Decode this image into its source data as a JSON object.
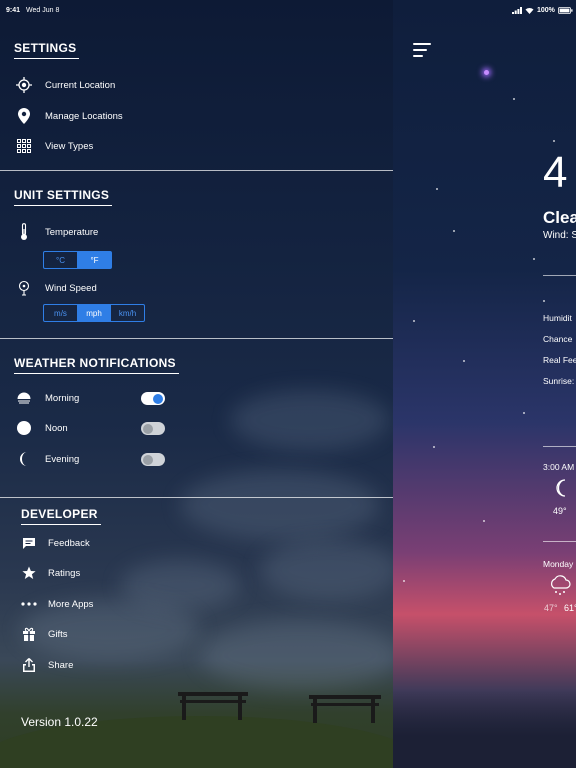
{
  "status_bar": {
    "time": "9:41",
    "date": "Wed Jun 8",
    "battery": "100%"
  },
  "settings": {
    "title": "SETTINGS",
    "items": [
      {
        "label": "Current Location",
        "icon": "location-crosshair-icon"
      },
      {
        "label": "Manage Locations",
        "icon": "map-pin-icon"
      },
      {
        "label": "View Types",
        "icon": "grid-icon"
      }
    ]
  },
  "unit_settings": {
    "title": "UNIT SETTINGS",
    "temperature": {
      "label": "Temperature",
      "options": [
        "°C",
        "°F"
      ],
      "selected": "°F"
    },
    "wind_speed": {
      "label": "Wind Speed",
      "options": [
        "m/s",
        "mph",
        "km/h"
      ],
      "selected": "mph"
    }
  },
  "weather_notifications": {
    "title": "WEATHER NOTIFICATIONS",
    "items": [
      {
        "label": "Morning",
        "icon": "sunrise-icon",
        "enabled": true
      },
      {
        "label": "Noon",
        "icon": "sun-icon",
        "enabled": false
      },
      {
        "label": "Evening",
        "icon": "moon-icon",
        "enabled": false
      }
    ]
  },
  "developer": {
    "title": "DEVELOPER",
    "items": [
      {
        "label": "Feedback",
        "icon": "message-icon"
      },
      {
        "label": "Ratings",
        "icon": "star-icon"
      },
      {
        "label": "More Apps",
        "icon": "more-icon"
      },
      {
        "label": "Gifts",
        "icon": "gift-icon"
      },
      {
        "label": "Share",
        "icon": "share-icon"
      }
    ]
  },
  "version": "Version 1.0.22",
  "weather_panel": {
    "temperature": "4",
    "condition": "Clea",
    "wind": "Wind: S",
    "details": [
      "Humidit",
      "Chance",
      "Real Fee",
      "Sunrise:"
    ],
    "hourly": {
      "time": "3:00 AM",
      "temp": "49°"
    },
    "daily": {
      "day": "Monday",
      "low": "47°",
      "high": "61°"
    }
  },
  "colors": {
    "accent": "#2f7ee6",
    "toggle_off": "#cfd3d8"
  }
}
